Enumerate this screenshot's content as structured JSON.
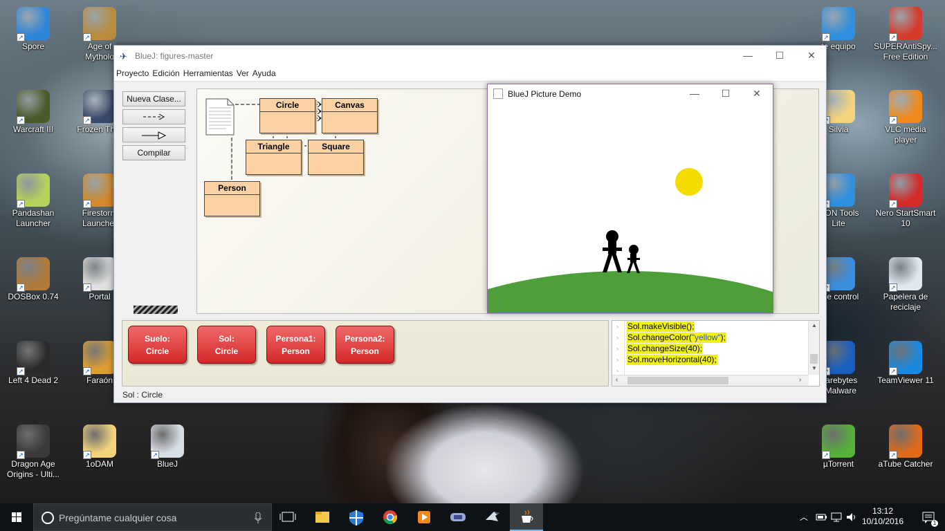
{
  "desktop": {
    "icons": [
      {
        "name": "desktop-icon-spore",
        "label": "Spore",
        "color": "#2e86d9"
      },
      {
        "name": "desktop-icon-age-of-mythology",
        "label": "Age of\nMytholo",
        "color": "#b88b3d"
      },
      {
        "name": "desktop-icon-warcraft-iii",
        "label": "Warcraft III",
        "color": "#4a5a2a"
      },
      {
        "name": "desktop-icon-frozen-throne",
        "label": "Frozen Thro",
        "color": "#3a4a6a"
      },
      {
        "name": "desktop-icon-pandashan",
        "label": "Pandashan\nLauncher",
        "color": "#b5d35a"
      },
      {
        "name": "desktop-icon-firestorm",
        "label": "Firestorm\nLauncher",
        "color": "#d38a2a"
      },
      {
        "name": "desktop-icon-dosbox",
        "label": "DOSBox 0.74",
        "color": "#b07a3a"
      },
      {
        "name": "desktop-icon-portal",
        "label": "Portal",
        "color": "#e0e0e0"
      },
      {
        "name": "desktop-icon-left-4-dead-2",
        "label": "Left 4 Dead 2",
        "color": "#2a2a2a"
      },
      {
        "name": "desktop-icon-faraon",
        "label": "Faraón",
        "color": "#e0a030"
      },
      {
        "name": "desktop-icon-dragon-age",
        "label": "Dragon Age\nOrigins - Ulti...",
        "color": "#3a3a3a"
      },
      {
        "name": "desktop-icon-1odam",
        "label": "1oDAM",
        "color": "#f3d37b"
      },
      {
        "name": "desktop-icon-bluej",
        "label": "BlueJ",
        "color": "#d8dee6"
      },
      {
        "name": "desktop-icon-este-equipo",
        "label": "te equipo",
        "color": "#2f8fe0"
      },
      {
        "name": "desktop-icon-superantispyware",
        "label": "SUPERAntiSpy...\nFree Edition",
        "color": "#d63a2a"
      },
      {
        "name": "desktop-icon-silvia",
        "label": "Silvia",
        "color": "#f3d37b"
      },
      {
        "name": "desktop-icon-vlc",
        "label": "VLC media player",
        "color": "#f08a1a"
      },
      {
        "name": "desktop-icon-daemon-tools",
        "label": "MON Tools\nLite",
        "color": "#2f8fe0"
      },
      {
        "name": "desktop-icon-nero",
        "label": "Nero StartSmart\n10",
        "color": "#d62a2a"
      },
      {
        "name": "desktop-icon-panel-control",
        "label": "l de control",
        "color": "#3a8ee0"
      },
      {
        "name": "desktop-icon-papelera",
        "label": "Papelera de\nreciclaje",
        "color": "#e0e8f0"
      },
      {
        "name": "desktop-icon-malwarebytes",
        "label": "warebytes\ni-Malware",
        "color": "#1a5fc0"
      },
      {
        "name": "desktop-icon-teamviewer",
        "label": "TeamViewer 11",
        "color": "#1a8ae0"
      },
      {
        "name": "desktop-icon-utorrent",
        "label": "µTorrent",
        "color": "#56b03a"
      },
      {
        "name": "desktop-icon-atube-catcher",
        "label": "aTube Catcher",
        "color": "#e06a1a"
      }
    ]
  },
  "bluej": {
    "title": "BlueJ:  figures-master",
    "menu": [
      "Proyecto",
      "Edición",
      "Herramientas",
      "Ver",
      "Ayuda"
    ],
    "toolbar": {
      "new_class": "Nueva Clase...",
      "compile": "Compilar"
    },
    "classes": [
      "Circle",
      "Canvas",
      "Triangle",
      "Square",
      "Person"
    ],
    "objects": [
      {
        "name": "Suelo:",
        "type": "Circle"
      },
      {
        "name": "Sol:",
        "type": "Circle"
      },
      {
        "name": "Persona1:",
        "type": "Person"
      },
      {
        "name": "Persona2:",
        "type": "Person"
      }
    ],
    "codepad": [
      {
        "pre": "Sol.makeVisible();",
        "str": "",
        "post": ""
      },
      {
        "pre": "Sol.changeColor(",
        "str": "\"yellow\"",
        "post": ");"
      },
      {
        "pre": "Sol.changeSize(40);",
        "str": "",
        "post": ""
      },
      {
        "pre": "Sol.moveHorizontal(40);",
        "str": "",
        "post": ""
      }
    ],
    "status": "Sol : Circle"
  },
  "demo": {
    "title": "BlueJ Picture Demo",
    "colors": {
      "sun": "#f5dc00",
      "ground": "#4e9f3a",
      "person": "#000000"
    }
  },
  "taskbar": {
    "search_placeholder": "Pregúntame cualquier cosa",
    "time": "13:12",
    "date": "10/10/2016"
  }
}
